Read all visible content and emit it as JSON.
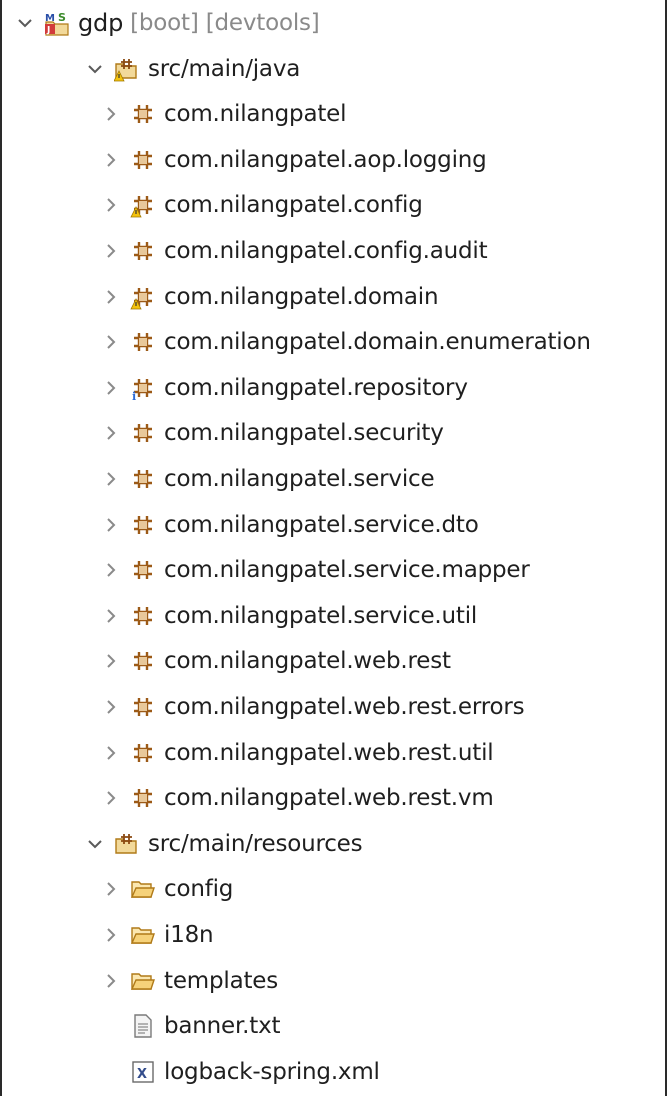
{
  "tree": [
    {
      "id": "project",
      "type": "project",
      "level": 0,
      "expanded": true,
      "name": "gdp",
      "decorations": "[boot] [devtools]",
      "icon": "spring-boot-project-icon"
    },
    {
      "id": "src-main-java",
      "type": "source-folder",
      "level": 1,
      "expanded": true,
      "name": "src/main/java",
      "icon": "source-folder-warning-icon"
    },
    {
      "id": "pkg-1",
      "type": "package",
      "level": 2,
      "expanded": false,
      "name": "com.nilangpatel",
      "icon": "package-icon"
    },
    {
      "id": "pkg-2",
      "type": "package",
      "level": 2,
      "expanded": false,
      "name": "com.nilangpatel.aop.logging",
      "icon": "package-icon"
    },
    {
      "id": "pkg-3",
      "type": "package",
      "level": 2,
      "expanded": false,
      "name": "com.nilangpatel.config",
      "icon": "package-warning-icon"
    },
    {
      "id": "pkg-4",
      "type": "package",
      "level": 2,
      "expanded": false,
      "name": "com.nilangpatel.config.audit",
      "icon": "package-icon"
    },
    {
      "id": "pkg-5",
      "type": "package",
      "level": 2,
      "expanded": false,
      "name": "com.nilangpatel.domain",
      "icon": "package-warning-icon"
    },
    {
      "id": "pkg-6",
      "type": "package",
      "level": 2,
      "expanded": false,
      "name": "com.nilangpatel.domain.enumeration",
      "icon": "package-icon"
    },
    {
      "id": "pkg-7",
      "type": "package",
      "level": 2,
      "expanded": false,
      "name": "com.nilangpatel.repository",
      "icon": "package-info-icon"
    },
    {
      "id": "pkg-8",
      "type": "package",
      "level": 2,
      "expanded": false,
      "name": "com.nilangpatel.security",
      "icon": "package-icon"
    },
    {
      "id": "pkg-9",
      "type": "package",
      "level": 2,
      "expanded": false,
      "name": "com.nilangpatel.service",
      "icon": "package-icon"
    },
    {
      "id": "pkg-10",
      "type": "package",
      "level": 2,
      "expanded": false,
      "name": "com.nilangpatel.service.dto",
      "icon": "package-icon"
    },
    {
      "id": "pkg-11",
      "type": "package",
      "level": 2,
      "expanded": false,
      "name": "com.nilangpatel.service.mapper",
      "icon": "package-icon"
    },
    {
      "id": "pkg-12",
      "type": "package",
      "level": 2,
      "expanded": false,
      "name": "com.nilangpatel.service.util",
      "icon": "package-icon"
    },
    {
      "id": "pkg-13",
      "type": "package",
      "level": 2,
      "expanded": false,
      "name": "com.nilangpatel.web.rest",
      "icon": "package-icon"
    },
    {
      "id": "pkg-14",
      "type": "package",
      "level": 2,
      "expanded": false,
      "name": "com.nilangpatel.web.rest.errors",
      "icon": "package-icon"
    },
    {
      "id": "pkg-15",
      "type": "package",
      "level": 2,
      "expanded": false,
      "name": "com.nilangpatel.web.rest.util",
      "icon": "package-icon"
    },
    {
      "id": "pkg-16",
      "type": "package",
      "level": 2,
      "expanded": false,
      "name": "com.nilangpatel.web.rest.vm",
      "icon": "package-icon"
    },
    {
      "id": "src-main-resources",
      "type": "source-folder",
      "level": 1,
      "expanded": true,
      "name": "src/main/resources",
      "icon": "source-folder-icon"
    },
    {
      "id": "folder-config",
      "type": "folder",
      "level": 2,
      "expanded": false,
      "name": "config",
      "icon": "folder-icon"
    },
    {
      "id": "folder-i18n",
      "type": "folder",
      "level": 2,
      "expanded": false,
      "name": "i18n",
      "icon": "folder-icon"
    },
    {
      "id": "folder-templates",
      "type": "folder",
      "level": 2,
      "expanded": false,
      "name": "templates",
      "icon": "folder-icon"
    },
    {
      "id": "file-banner",
      "type": "file",
      "level": 2,
      "expanded": null,
      "name": "banner.txt",
      "icon": "text-file-icon"
    },
    {
      "id": "file-logback",
      "type": "file",
      "level": 2,
      "expanded": null,
      "name": "logback-spring.xml",
      "icon": "xml-file-icon"
    }
  ]
}
